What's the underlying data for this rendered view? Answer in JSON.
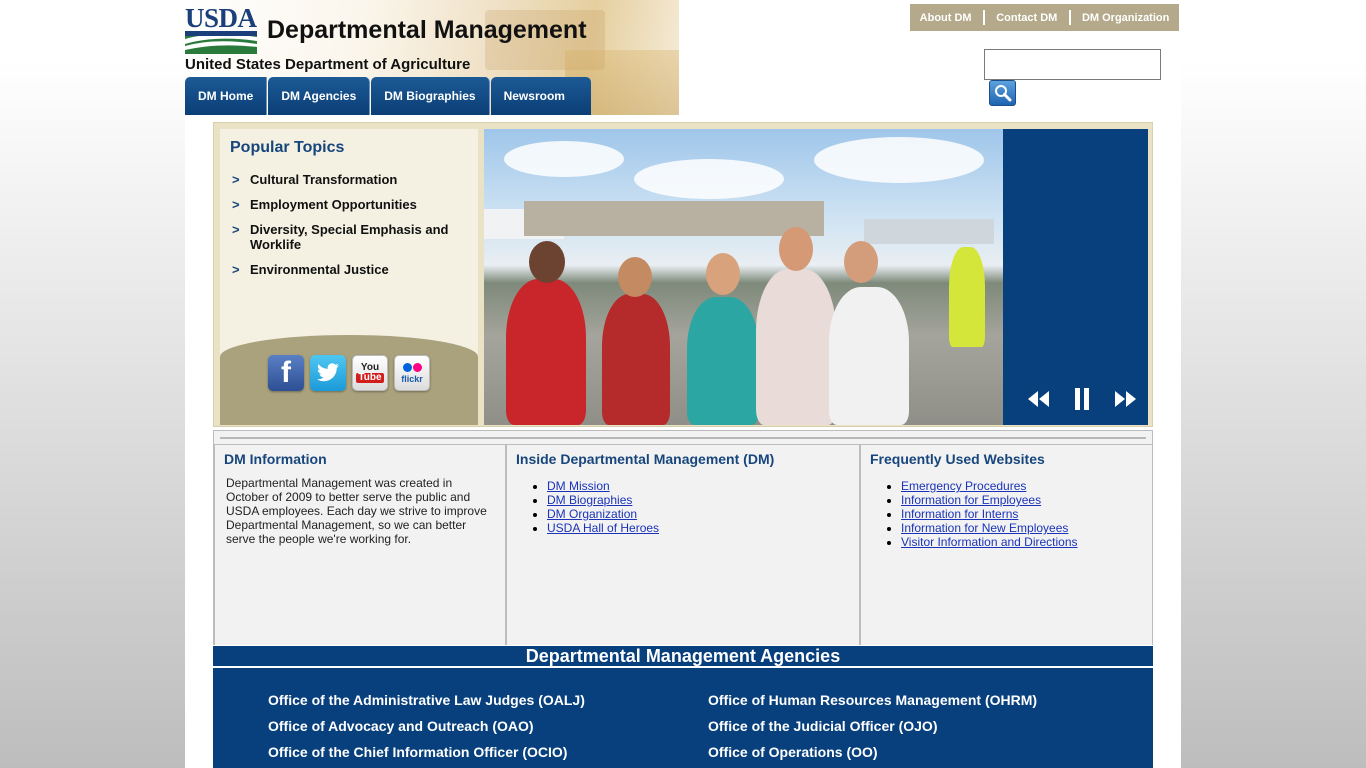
{
  "header": {
    "logo_text": "USDA",
    "title": "Departmental Management",
    "subtitle": "United States Department of Agriculture",
    "nav": [
      "DM Home",
      "DM Agencies",
      "DM Biographies",
      "Newsroom"
    ],
    "top_links": [
      "About DM",
      "Contact DM",
      "DM Organization"
    ],
    "search": {
      "value": "",
      "placeholder": ""
    }
  },
  "popular": {
    "title": "Popular Topics",
    "items": [
      "Cultural Transformation",
      "Employment Opportunities",
      "Diversity, Special Emphasis and Worklife",
      "Environmental Justice"
    ],
    "chevron": ">",
    "social": [
      "facebook-icon",
      "twitter-icon",
      "youtube-icon",
      "flickr-icon"
    ],
    "social_text": {
      "facebook": "f",
      "youtube_top": "You",
      "youtube_bottom": "Tube",
      "flickr": "flickr"
    }
  },
  "slideshow": {
    "controls": [
      "rewind-icon",
      "pause-icon",
      "fast-forward-icon"
    ]
  },
  "info": {
    "dm_information": {
      "title": "DM Information",
      "text": "Departmental Management was created in October of 2009 to better serve the public and USDA employees. Each day we strive to improve Departmental Management, so we can better serve the people we're working for."
    },
    "inside_dm": {
      "title": "Inside Departmental Management (DM)",
      "links": [
        "DM Mission",
        "DM Biographies",
        "DM Organization",
        "USDA Hall of Heroes"
      ]
    },
    "frequent_sites": {
      "title": "Frequently Used Websites",
      "links": [
        "Emergency Procedures",
        "Information for Employees",
        "Information for Interns",
        "Information for New Employees",
        "Visitor Information and Directions"
      ]
    }
  },
  "agencies": {
    "title": "Departmental Management Agencies",
    "left": [
      "Office of the Administrative Law Judges (OALJ)",
      "Office of Advocacy and Outreach (OAO)",
      "Office of the Chief Information Officer (OCIO)"
    ],
    "right": [
      "Office of Human Resources Management (OHRM)",
      "Office of the Judicial Officer (OJO)",
      "Office of Operations (OO)"
    ]
  },
  "colors": {
    "navy": "#08407d",
    "title_blue": "#17467d",
    "tan": "#b4a98a",
    "link": "#1a33b8"
  }
}
